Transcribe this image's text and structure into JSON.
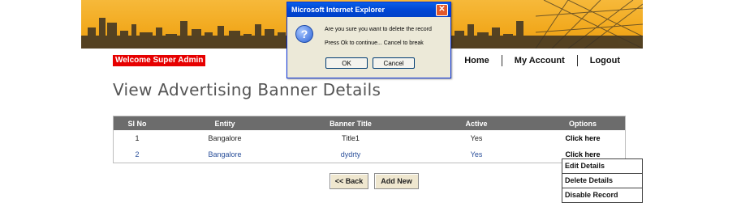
{
  "welcome": "Welcome Super Admin",
  "nav": {
    "home": "Home",
    "account": "My Account",
    "logout": "Logout"
  },
  "title": "View Advertising Banner Details",
  "table": {
    "headers": [
      "Sl No",
      "Entity",
      "Banner Title",
      "Active",
      "Options"
    ],
    "rows": [
      [
        "1",
        "Bangalore",
        "Title1",
        "Yes",
        "Click here"
      ],
      [
        "2",
        "Bangalore",
        "dydrty",
        "Yes",
        "Click here"
      ]
    ]
  },
  "buttons": {
    "back": "<< Back",
    "add_new": "Add New"
  },
  "menu": [
    "Edit Details",
    "Delete Details",
    "Disable Record"
  ],
  "dialog": {
    "title": "Microsoft Internet Explorer",
    "message": "Are you sure you want to delete the record",
    "hint": "Press Ok to continue... Cancel to break",
    "ok": "OK",
    "cancel": "Cancel"
  }
}
